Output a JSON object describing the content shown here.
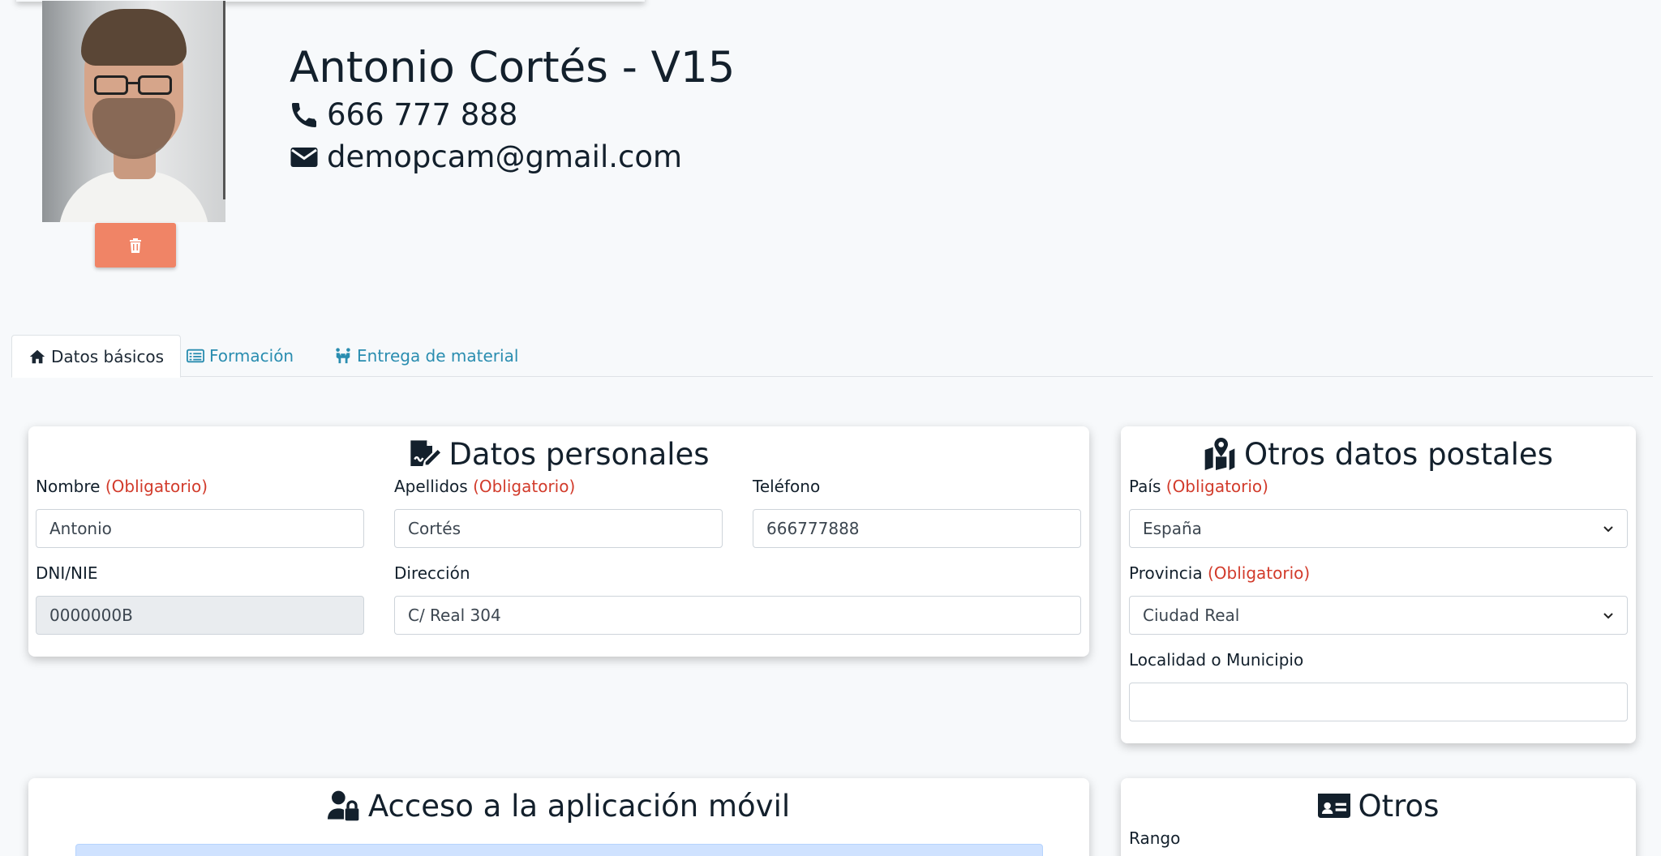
{
  "profile": {
    "name": "Antonio Cortés - V15",
    "phone": "666 777 888",
    "email": "demopcam@gmail.com"
  },
  "tabs": [
    {
      "label": "Datos básicos",
      "icon": "home-icon",
      "active": true
    },
    {
      "label": "Formación",
      "icon": "list-alt-icon",
      "active": false
    },
    {
      "label": "Entrega de material",
      "icon": "people-carry-icon",
      "active": false
    }
  ],
  "personal": {
    "title": "Datos personales",
    "required_tag": "(Obligatorio)",
    "nombre": {
      "label": "Nombre",
      "value": "Antonio"
    },
    "apellidos": {
      "label": "Apellidos",
      "value": "Cortés"
    },
    "telefono": {
      "label": "Teléfono",
      "value": "666777888"
    },
    "dni": {
      "label": "DNI/NIE",
      "value": "0000000B"
    },
    "direccion": {
      "label": "Dirección",
      "value": "C/ Real 304"
    }
  },
  "postal": {
    "title": "Otros datos postales",
    "pais": {
      "label": "País",
      "value": "España"
    },
    "provincia": {
      "label": "Provincia",
      "value": "Ciudad Real"
    },
    "localidad": {
      "label": "Localidad o Municipio",
      "value": ""
    }
  },
  "mobile": {
    "title": "Acceso a la aplicación móvil"
  },
  "otros": {
    "title": "Otros",
    "rango_label": "Rango"
  },
  "colors": {
    "accent": "#2a8db0",
    "danger_button": "#f08466",
    "required": "#d23b2b"
  }
}
